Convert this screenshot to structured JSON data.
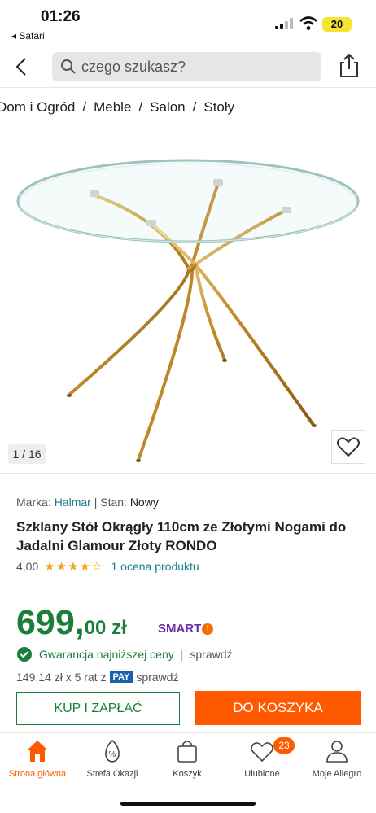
{
  "status": {
    "time": "01:26",
    "back_app": "◂ Safari",
    "battery": "20"
  },
  "search": {
    "placeholder": "czego szukasz?"
  },
  "breadcrumbs": [
    "Dom i Ogród",
    "Meble",
    "Salon",
    "Stoły"
  ],
  "gallery": {
    "counter": "1 / 16"
  },
  "product": {
    "brand_label": "Marka:",
    "brand": "Halmar",
    "state_label": "| Stan:",
    "state": "Nowy",
    "title": "Szklany Stół Okrągły 110cm ze Złotymi Nogami do Jadalni Glamour Złoty RONDO",
    "rating": "4,00",
    "rating_stars": 4,
    "stars": "★★★★☆",
    "rating_link": "1 ocena produktu",
    "price_main": "699,",
    "price_rest": "00 zł",
    "smart_label": "SMART",
    "guarantee": "Gwarancja najniższej ceny",
    "guarantee_sep": "|",
    "guarantee_check": "sprawdź",
    "installments": "149,14 zł x 5 rat z",
    "pay_label": "PAY",
    "installments_check": "sprawdź"
  },
  "cta": {
    "buy": "KUP I ZAPŁAĆ",
    "cart": "DO KOSZYKA"
  },
  "tabs": [
    {
      "label": "Strona główna",
      "icon": "home-icon"
    },
    {
      "label": "Strefa Okazji",
      "icon": "percent-tag-icon"
    },
    {
      "label": "Koszyk",
      "icon": "bag-icon"
    },
    {
      "label": "Ulubione",
      "icon": "heart-icon"
    },
    {
      "label": "Moje Allegro",
      "icon": "user-icon"
    }
  ],
  "favorites_badge": "23",
  "colors": {
    "accent": "#ff5a00",
    "green": "#1a7f3a",
    "teal": "#1a7f8a",
    "smart": "#6b2fa8",
    "battery": "#f5e432"
  }
}
